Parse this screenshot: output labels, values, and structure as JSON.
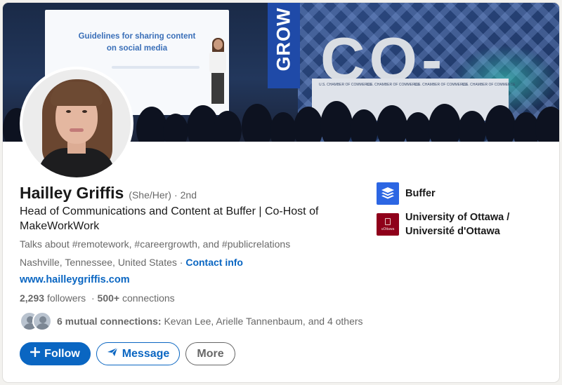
{
  "banner": {
    "screen_title": "Guidelines for sharing content\non social media",
    "sign_text": "GROW",
    "co_text": "CO-",
    "stage_label": "U.S. CHAMBER OF COMMERCE"
  },
  "profile": {
    "name": "Hailley Griffis",
    "pronouns": "(She/Her)",
    "degree_sep": "·",
    "degree": "2nd",
    "headline": "Head of Communications and Content at Buffer | Co-Host of MakeWorkWork",
    "talks_about": "Talks about #remotework, #careergrowth, and #publicrelations",
    "location": "Nashville, Tennessee, United States",
    "location_sep": "·",
    "contact_label": "Contact info",
    "website": "www.hailleygriffis.com",
    "followers": "2,293",
    "followers_label": "followers",
    "stats_sep": "·",
    "connections": "500+",
    "connections_label": "connections",
    "mutual_count": "6 mutual connections:",
    "mutual_names": "Kevan Lee, Arielle Tannenbaum, and 4 others"
  },
  "actions": {
    "follow_label": "Follow",
    "message_label": "Message",
    "more_label": "More"
  },
  "experience": [
    {
      "name": "Buffer",
      "logo_color": "#2c66e3"
    },
    {
      "name": "University of Ottawa / Université d'Ottawa",
      "logo_color": "#8f001a",
      "logo_text": "uOttawa"
    }
  ],
  "colors": {
    "accent": "#0a66c2",
    "background": "#f3f2ef"
  }
}
